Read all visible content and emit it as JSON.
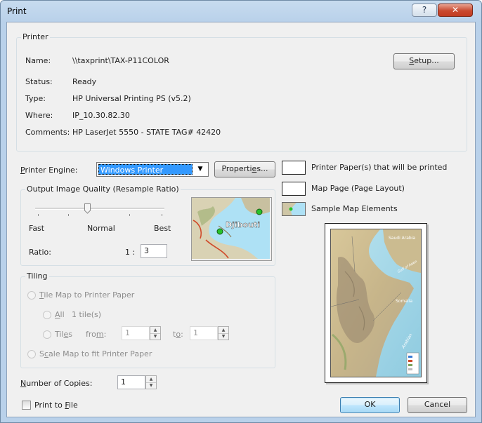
{
  "window": {
    "title": "Print",
    "help_glyph": "?",
    "close_glyph": "✕"
  },
  "printer": {
    "group_label": "Printer",
    "name_label": "Name:",
    "name_value": "\\\\taxprint\\TAX-P11COLOR",
    "status_label": "Status:",
    "status_value": "Ready",
    "type_label": "Type:",
    "type_value": "HP Universal Printing PS (v5.2)",
    "where_label": "Where:",
    "where_value": "IP_10.30.82.30",
    "comments_label": "Comments:",
    "comments_value": "HP LaserJet 5550 - STATE TAG# 42420",
    "setup_pre": "",
    "setup_key": "S",
    "setup_post": "etup..."
  },
  "engine": {
    "label_key": "P",
    "label_rest": "rinter Engine:",
    "selected": "Windows Printer",
    "properties_pre": "Properti",
    "properties_key": "e",
    "properties_post": "s..."
  },
  "quality": {
    "group_label": "Output Image Quality (Resample Ratio)",
    "fast": "Fast",
    "normal": "Normal",
    "best": "Best",
    "slider_position": 0.5,
    "ratio_label": "Ratio:",
    "ratio_prefix": "1 :",
    "ratio_value": "3",
    "preview_label": "Djibouti"
  },
  "tiling": {
    "group_label": "Tiling",
    "tile_map_key": "T",
    "tile_map_rest": "ile Map to Printer Paper",
    "all_key": "A",
    "all_rest": "ll",
    "all_count": "1 tile(s)",
    "tiles_pre": "Til",
    "tiles_key": "e",
    "tiles_post": "s",
    "from_pre": "fro",
    "from_key": "m",
    "from_post": ":",
    "from_value": "1",
    "to_pre": "t",
    "to_key": "o",
    "to_post": ":",
    "to_value": "1",
    "scale_pre": "S",
    "scale_key": "c",
    "scale_post": "ale Map to fit Printer Paper"
  },
  "copies": {
    "label_key": "N",
    "label_rest": "umber of Copies:",
    "value": "1"
  },
  "print_to_file": {
    "pre": "Print to ",
    "key": "F",
    "post": "ile",
    "checked": false
  },
  "legend": {
    "printer_paper": "Printer Paper(s) that will be printed",
    "map_page": "Map Page (Page Layout)",
    "sample_elements": "Sample Map Elements"
  },
  "map_labels": {
    "saudi_arabia": "Saudi Arabia",
    "gulf_of_aden": "Gulf of Aden",
    "somalia": "Somalia",
    "arabian_sea": "Arabian"
  },
  "buttons": {
    "ok": "OK",
    "cancel": "Cancel"
  },
  "colors": {
    "title_bg": "#b9d1ea",
    "dialog_bg": "#f0f0f0",
    "selection": "#3399ff",
    "close_red": "#c94a30",
    "sea": "#aee1f5",
    "land": "#d9d2b4",
    "city_dot": "#27c22a"
  }
}
